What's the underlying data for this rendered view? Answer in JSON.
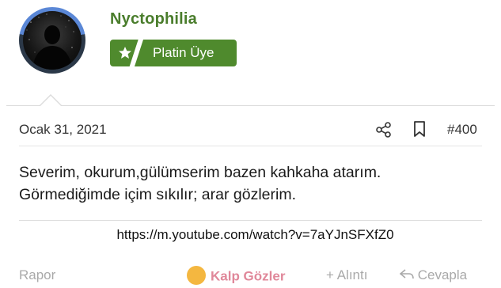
{
  "user": {
    "name": "Nyctophilia",
    "rank_label": "Platin Üye",
    "colors": {
      "name": "#4a7d2c",
      "badge": "#4f8a2d",
      "avatar_ring": "#5a87d6"
    }
  },
  "post": {
    "date": "Ocak 31, 2021",
    "number": "#400",
    "body_lines": [
      "Severim, okurum,gülümserim bazen kahkaha atarım.",
      "Görmediğimde içim sıkılır; arar gözlerim."
    ],
    "link": "https://m.youtube.com/watch?v=7aYJnSFXfZ0"
  },
  "actions": {
    "report": "Rapor",
    "reaction": "Kalp Gözler",
    "quote": "+ Alıntı",
    "reply": "Cevapla"
  },
  "icons": {
    "share": "share-icon",
    "bookmark": "bookmark-icon",
    "badge": "star-badge-icon"
  }
}
